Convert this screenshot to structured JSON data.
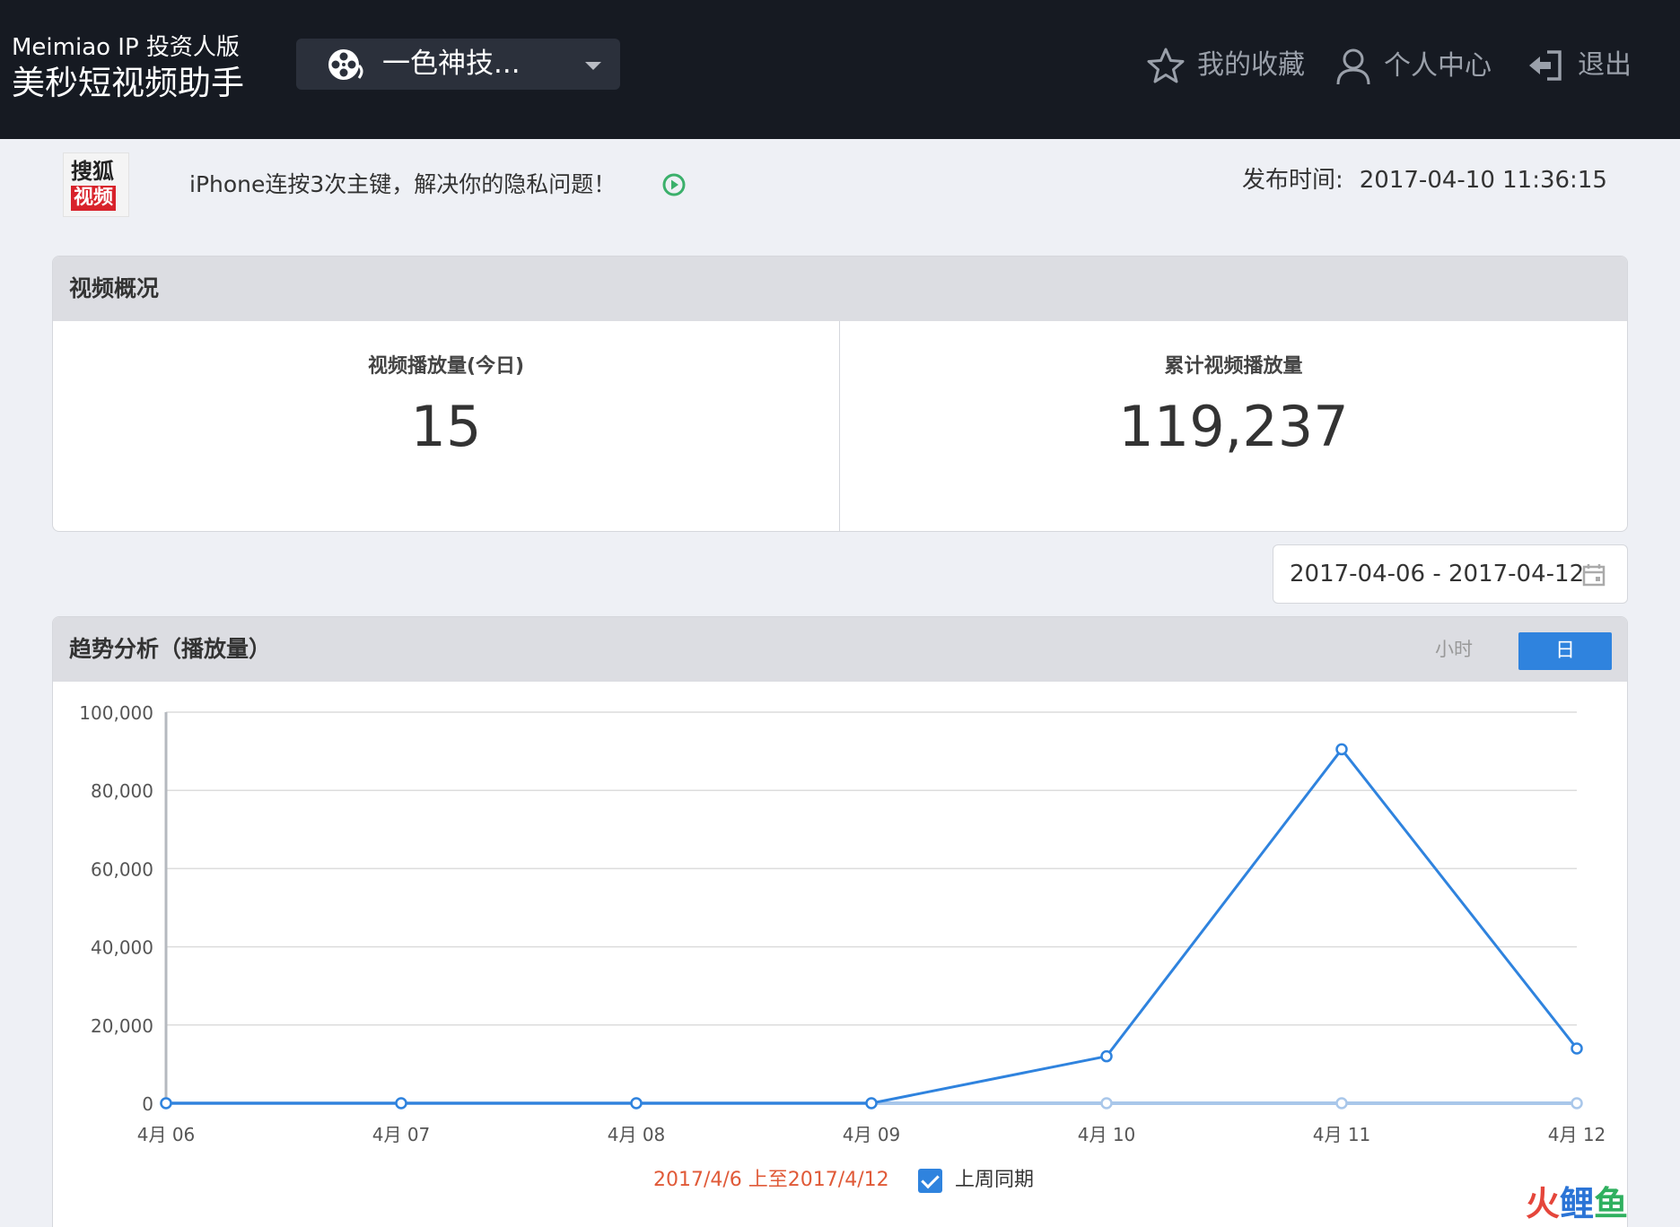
{
  "brand": {
    "subtitle": "Meimiao IP 投资人版",
    "title": "美秒短视频助手"
  },
  "selector": {
    "value": "一色神技..."
  },
  "nav": {
    "favorites": "我的收藏",
    "profile": "个人中心",
    "logout": "退出"
  },
  "video": {
    "platform_logo_line1": "搜狐",
    "platform_logo_line2": "视频",
    "title": "iPhone连按3次主键，解决你的隐私问题！",
    "publish_label": "发布时间:",
    "publish_time": "2017-04-10 11:36:15"
  },
  "overview": {
    "title": "视频概况",
    "today_label": "视频播放量(今日)",
    "today_value": "15",
    "total_label": "累计视频播放量",
    "total_value": "119,237"
  },
  "date_range": {
    "value": "2017-04-06 - 2017-04-12"
  },
  "trend": {
    "title": "趋势分析（播放量）",
    "toggle_hour": "小时",
    "toggle_day": "日",
    "legend_current": "2017/4/6 上至2017/4/12",
    "legend_previous": "上周同期"
  },
  "colors": {
    "accent": "#2f83de",
    "current_series": "#2f83de",
    "previous_series": "#a9c7ea",
    "legend_current_text": "#e05a38"
  },
  "watermark": {
    "a": "火",
    "b": "鲤",
    "c": "鱼"
  },
  "chart_data": {
    "type": "line",
    "categories": [
      "4月 06",
      "4月 07",
      "4月 08",
      "4月 09",
      "4月 10",
      "4月 11",
      "4月 12"
    ],
    "ylim": [
      0,
      100000
    ],
    "y_ticks": [
      0,
      20000,
      40000,
      60000,
      80000,
      100000
    ],
    "y_tick_labels": [
      "0",
      "20,000",
      "40,000",
      "60,000",
      "80,000",
      "100,000"
    ],
    "grid": true,
    "legend_position": "bottom-center",
    "series": [
      {
        "name": "2017/4/6 上至2017/4/12",
        "values": [
          0,
          0,
          0,
          0,
          12000,
          90500,
          14000
        ]
      },
      {
        "name": "上周同期",
        "values": [
          0,
          0,
          0,
          0,
          0,
          0,
          0
        ]
      }
    ]
  }
}
